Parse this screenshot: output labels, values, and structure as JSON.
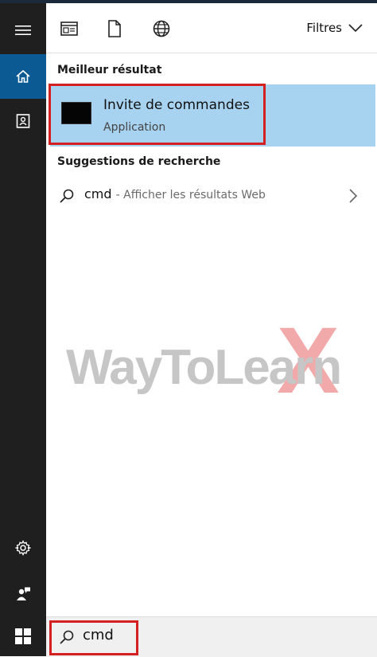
{
  "toolbar": {
    "icons": [
      "apps-icon",
      "document-icon",
      "web-globe-icon"
    ],
    "filter_label": "Filtres"
  },
  "sidebar": {
    "items": [
      {
        "name": "menu-icon"
      },
      {
        "name": "home-icon",
        "active": true
      },
      {
        "name": "notebook-icon"
      },
      {
        "name": "settings-gear-icon"
      },
      {
        "name": "feedback-user-icon"
      },
      {
        "name": "windows-start-icon"
      }
    ]
  },
  "best_match": {
    "section_title": "Meilleur résultat",
    "title": "Invite de commandes",
    "subtitle": "Application"
  },
  "suggestions": {
    "section_title": "Suggestions de recherche",
    "items": [
      {
        "query": "cmd",
        "description": "- Afficher les résultats Web"
      }
    ]
  },
  "watermark": {
    "text": "WayToLearn",
    "accent": "X"
  },
  "search": {
    "value": "cmd"
  },
  "colors": {
    "accent": "#0c5a93",
    "highlight": "#a8d3f0",
    "outline_red": "#d42020",
    "sidebar_bg": "#1f1f1f"
  }
}
